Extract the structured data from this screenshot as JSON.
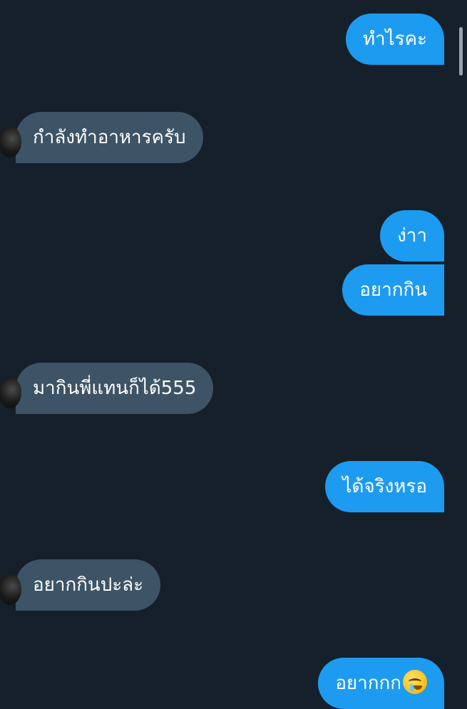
{
  "messages": [
    {
      "direction": "outgoing",
      "text": "ทำไรคะ"
    },
    {
      "direction": "incoming",
      "text": "กำลังทำอาหารครับ"
    },
    {
      "direction": "outgoing",
      "text": "ง่าา"
    },
    {
      "direction": "outgoing",
      "text": "อยากกิน"
    },
    {
      "direction": "incoming",
      "text": "มากินพี่แทนก็ได้555"
    },
    {
      "direction": "outgoing",
      "text": "ได้จริงหรอ"
    },
    {
      "direction": "incoming",
      "text": "อยากกินปะล่ะ"
    },
    {
      "direction": "outgoing",
      "text": "อยากกก",
      "emoji": "drooling-face-emoji"
    }
  ],
  "colors": {
    "background": "#15202b",
    "outgoing_bubble": "#1d9bf0",
    "incoming_bubble": "#3d5466",
    "text": "#ffffff"
  }
}
